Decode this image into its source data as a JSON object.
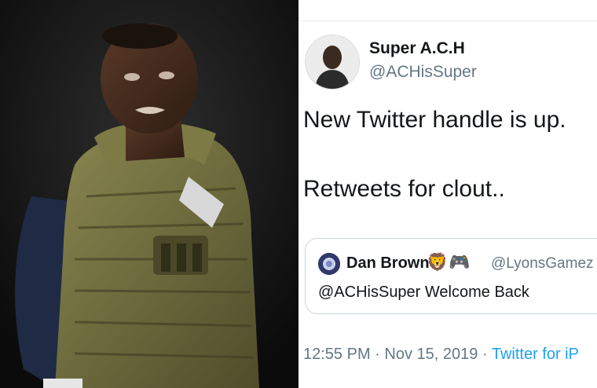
{
  "tweet": {
    "author_name": "Super A.C.H",
    "author_handle": "@ACHisSuper",
    "text_line_1": "New Twitter handle is up.",
    "text_line_2": "Retweets for clout..",
    "quoted": {
      "name": "Dan Brown",
      "emoji_1": "🦁",
      "emoji_2": "🎮",
      "handle": "@LyonsGamez",
      "text": "@ACHisSuper Welcome Back"
    },
    "time": "12:55 PM",
    "sep": "·",
    "date": "Nov 15, 2019",
    "source": "Twitter for iP"
  },
  "colors": {
    "text": "#14171a",
    "secondary": "#657786",
    "link": "#1da1f2",
    "border": "#ccd6dd",
    "vest": "#6b6a3a"
  },
  "icons": [
    "wrestler-photo",
    "author-avatar",
    "quoted-avatar"
  ]
}
